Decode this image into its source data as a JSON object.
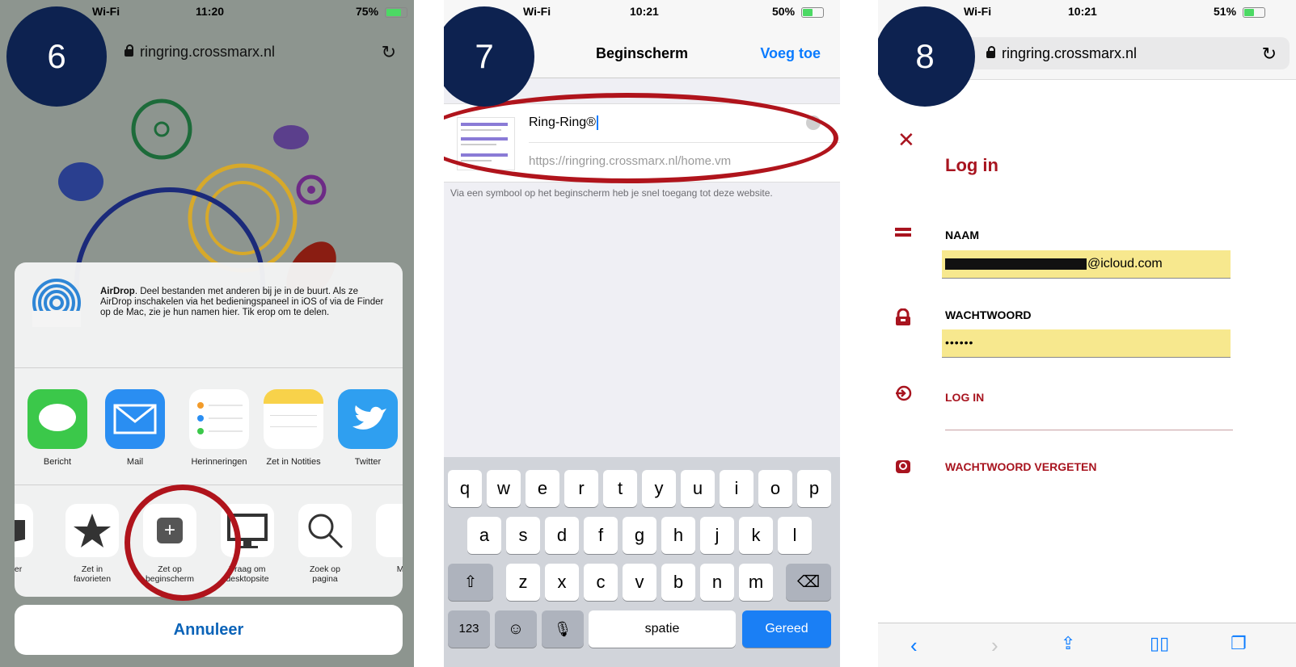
{
  "panel6": {
    "badge": "6",
    "status": {
      "left": "Wi-Fi",
      "time": "11:20",
      "battery": "75%",
      "battery_level": 0.75
    },
    "url": "ringring.crossmarx.nl",
    "airdrop_title": "AirDrop",
    "airdrop_text": ". Deel bestanden met anderen bij je in de buurt. Als ze AirDrop inschakelen via het bedieningspaneel in iOS of via de Finder op de Mac, zie je hun namen hier. Tik erop om te delen.",
    "apps": [
      "Bericht",
      "Mail",
      "Herinneringen",
      "Zet in Notities",
      "Twitter"
    ],
    "actions": [
      {
        "line1": "adwijzer",
        "line2": ""
      },
      {
        "line1": "Zet in",
        "line2": "favorieten"
      },
      {
        "line1": "Zet op",
        "line2": "beginscherm"
      },
      {
        "line1": "Vraag om",
        "line2": "desktopsite"
      },
      {
        "line1": "Zoek op",
        "line2": "pagina"
      },
      {
        "line1": "Ma",
        "line2": ""
      }
    ],
    "cancel": "Annuleer",
    "colors": {
      "accent": "#0a63b8",
      "highlight": "#b0141c"
    }
  },
  "panel7": {
    "badge": "7",
    "status": {
      "left": "Wi-Fi",
      "time": "10:21",
      "battery": "50%",
      "battery_level": 0.5
    },
    "title": "Beginscherm",
    "add_button": "Voeg toe",
    "name_value": "Ring-Ring®",
    "url_value": "https://ringring.crossmarx.nl/home.vm",
    "hint": "Via een symbool op het beginscherm heb je snel toegang tot deze website.",
    "keyboard": {
      "row1": [
        "q",
        "w",
        "e",
        "r",
        "t",
        "y",
        "u",
        "i",
        "o",
        "p"
      ],
      "row2": [
        "a",
        "s",
        "d",
        "f",
        "g",
        "h",
        "j",
        "k",
        "l"
      ],
      "row3": [
        "z",
        "x",
        "c",
        "v",
        "b",
        "n",
        "m"
      ],
      "numbers": "123",
      "space": "spatie",
      "done": "Gereed"
    }
  },
  "panel8": {
    "badge": "8",
    "status": {
      "left": "Wi-Fi",
      "time": "10:21",
      "battery": "51%",
      "battery_level": 0.51
    },
    "url": "ringring.crossmarx.nl",
    "title": "Log in",
    "name_label": "NAAM",
    "name_value": "@icloud.com",
    "password_label": "WACHTWOORD",
    "password_value": "••••••",
    "login_link": "LOG IN",
    "forgot_link": "WACHTWOORD VERGETEN",
    "colors": {
      "brand": "#a8141f",
      "field": "#f7e88e"
    }
  },
  "badge_color": "#0d2250"
}
